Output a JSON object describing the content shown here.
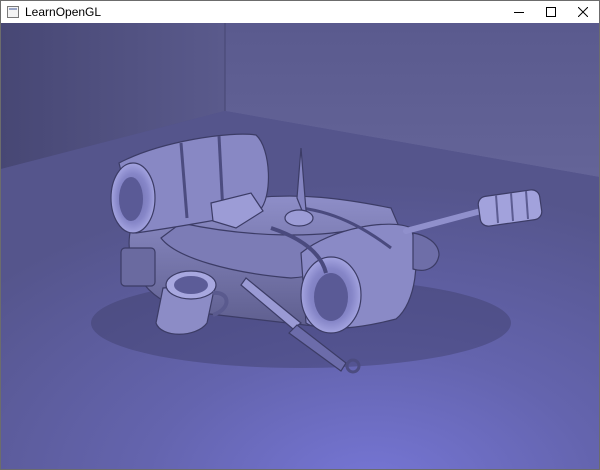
{
  "window": {
    "title": "LearnOpenGL",
    "icon": "opengl-app-icon",
    "controls": {
      "minimize": "minimize-icon",
      "maximize": "maximize-icon",
      "close": "close-icon"
    }
  },
  "scene": {
    "description_icon": "backpack-model",
    "colors": {
      "wall_left": "#4b4b7e",
      "wall_back": "#5a5a92",
      "floor": "#6060a8",
      "floor_highlight": "#7474d2",
      "model_base": "#74749e",
      "model_light": "#9a9ad8",
      "model_dark": "#3a3a62"
    }
  }
}
